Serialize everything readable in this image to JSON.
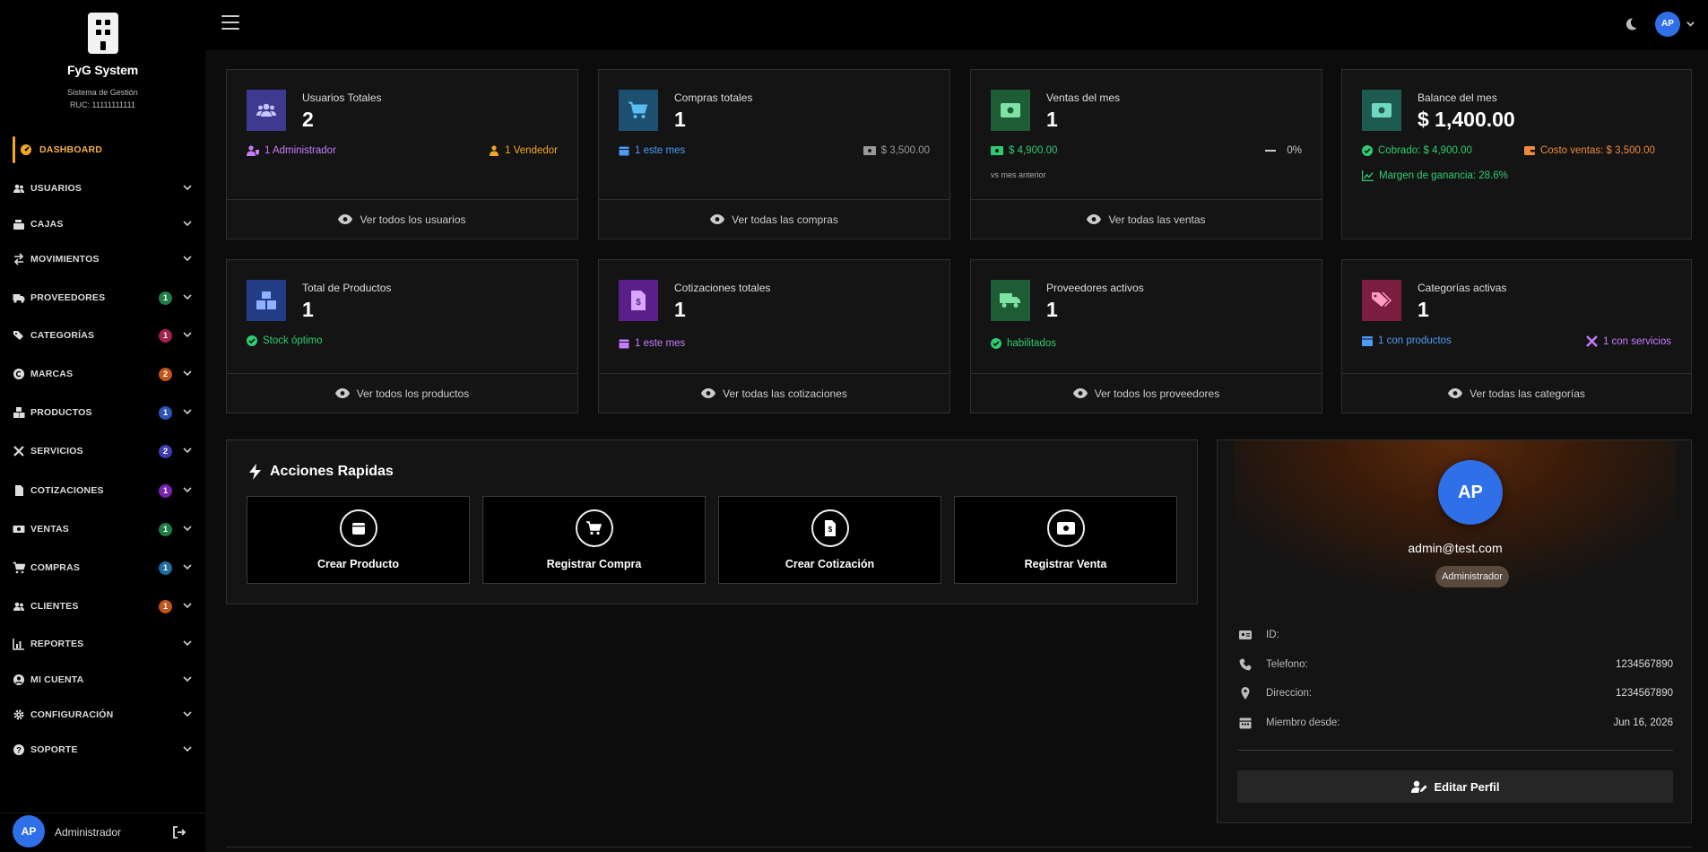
{
  "brand": {
    "name": "FyG System",
    "subtitle": "Sistema de Gestión",
    "ruc": "RUC: 11111111111"
  },
  "sidebar": {
    "items": [
      {
        "label": "DASHBOARD",
        "icon": "dashboard-icon",
        "active": true
      },
      {
        "label": "USUARIOS",
        "icon": "users-icon"
      },
      {
        "label": "CAJAS",
        "icon": "cash-register-icon"
      },
      {
        "label": "MOVIMIENTOS",
        "icon": "exchange-icon"
      },
      {
        "label": "PROVEEDORES",
        "icon": "truck-icon",
        "badge": "1",
        "badge_color": "#1e7d46"
      },
      {
        "label": "CATEGORÍAS",
        "icon": "tags-icon",
        "badge": "1",
        "badge_color": "#a3204a"
      },
      {
        "label": "MARCAS",
        "icon": "copyright-icon",
        "badge": "2",
        "badge_color": "#c0541a"
      },
      {
        "label": "PRODUCTOS",
        "icon": "boxes-icon",
        "badge": "1",
        "badge_color": "#2c55b8"
      },
      {
        "label": "SERVICIOS",
        "icon": "tools-icon",
        "badge": "2",
        "badge_color": "#3e3cb0"
      },
      {
        "label": "COTIZACIONES",
        "icon": "invoice-icon",
        "badge": "1",
        "badge_color": "#7b23b0"
      },
      {
        "label": "VENTAS",
        "icon": "money-bill-icon",
        "badge": "1",
        "badge_color": "#1e7d46"
      },
      {
        "label": "COMPRAS",
        "icon": "cart-icon",
        "badge": "1",
        "badge_color": "#1f6c9e"
      },
      {
        "label": "CLIENTES",
        "icon": "clients-icon",
        "badge": "1",
        "badge_color": "#c0541a"
      },
      {
        "label": "REPORTES",
        "icon": "chart-icon"
      },
      {
        "label": "MI CUENTA",
        "icon": "user-circle-icon"
      },
      {
        "label": "CONFIGURACIÓN",
        "icon": "gear-icon"
      },
      {
        "label": "SOPORTE",
        "icon": "help-icon"
      }
    ],
    "footer": {
      "avatar": "AP",
      "user": "Administrador"
    }
  },
  "topbar": {
    "avatar": "AP"
  },
  "cards": [
    {
      "title": "Usuarios Totales",
      "value": "2",
      "line1": "1 Administrador",
      "line1_right": "1 Vendedor",
      "footer": "Ver todos los usuarios",
      "color": "#3d3a8f"
    },
    {
      "title": "Compras totales",
      "value": "1",
      "line1": "1 este mes",
      "line1_right": "$ 3,500.00",
      "footer": "Ver todas las compras",
      "color": "#1d4f6e"
    },
    {
      "title": "Ventas del mes",
      "value": "1",
      "line1": "$ 4,900.00",
      "line1_right": "0%",
      "sub": "vs mes anterior",
      "footer": "Ver todas las ventas",
      "color": "#1e5c35"
    },
    {
      "title": "Balance del mes",
      "value": "$ 1,400.00",
      "line1": "Cobrado: $ 4,900.00",
      "line1_right": "Costo ventas: $ 3,500.00",
      "line2": "Margen de ganancia: 28.6%",
      "color": "#1e5a50"
    },
    {
      "title": "Total de Productos",
      "value": "1",
      "line1": "Stock óptimo",
      "footer": "Ver todos los productos",
      "color": "#223d86"
    },
    {
      "title": "Cotizaciones totales",
      "value": "1",
      "line1": "1 este mes",
      "footer": "Ver todas las cotizaciones",
      "color": "#5a1f8a"
    },
    {
      "title": "Proveedores activos",
      "value": "1",
      "line1": "habilitados",
      "footer": "Ver todos los proveedores",
      "color": "#1e5c35"
    },
    {
      "title": "Categorías activas",
      "value": "1",
      "line1": "1 con productos",
      "line1_right": "1 con servicios",
      "footer": "Ver todas las categorías",
      "color": "#7a1d3f"
    }
  ],
  "quick_actions": {
    "title": "Acciones Rapidas",
    "buttons": [
      {
        "label": "Crear Producto",
        "icon": "box-icon"
      },
      {
        "label": "Registrar Compra",
        "icon": "cart-icon"
      },
      {
        "label": "Crear Cotización",
        "icon": "invoice-icon"
      },
      {
        "label": "Registrar Venta",
        "icon": "money-bill-icon"
      }
    ]
  },
  "profile": {
    "avatar": "AP",
    "email": "admin@test.com",
    "role": "Administrador",
    "rows": [
      {
        "key": "ID:",
        "value": ""
      },
      {
        "key": "Telefono:",
        "value": "1234567890"
      },
      {
        "key": "Direccion:",
        "value": "1234567890"
      },
      {
        "key": "Miembro desde:",
        "value": "Jun 16, 2026"
      }
    ],
    "edit_label": "Editar Perfil"
  },
  "colors": {
    "accent": "#f5a623",
    "avatar_blue": "#2f6fe8",
    "link_blue": "#4b9cf5",
    "green": "#2ecc71",
    "orange": "#f5a623",
    "purple": "#c77dff"
  }
}
